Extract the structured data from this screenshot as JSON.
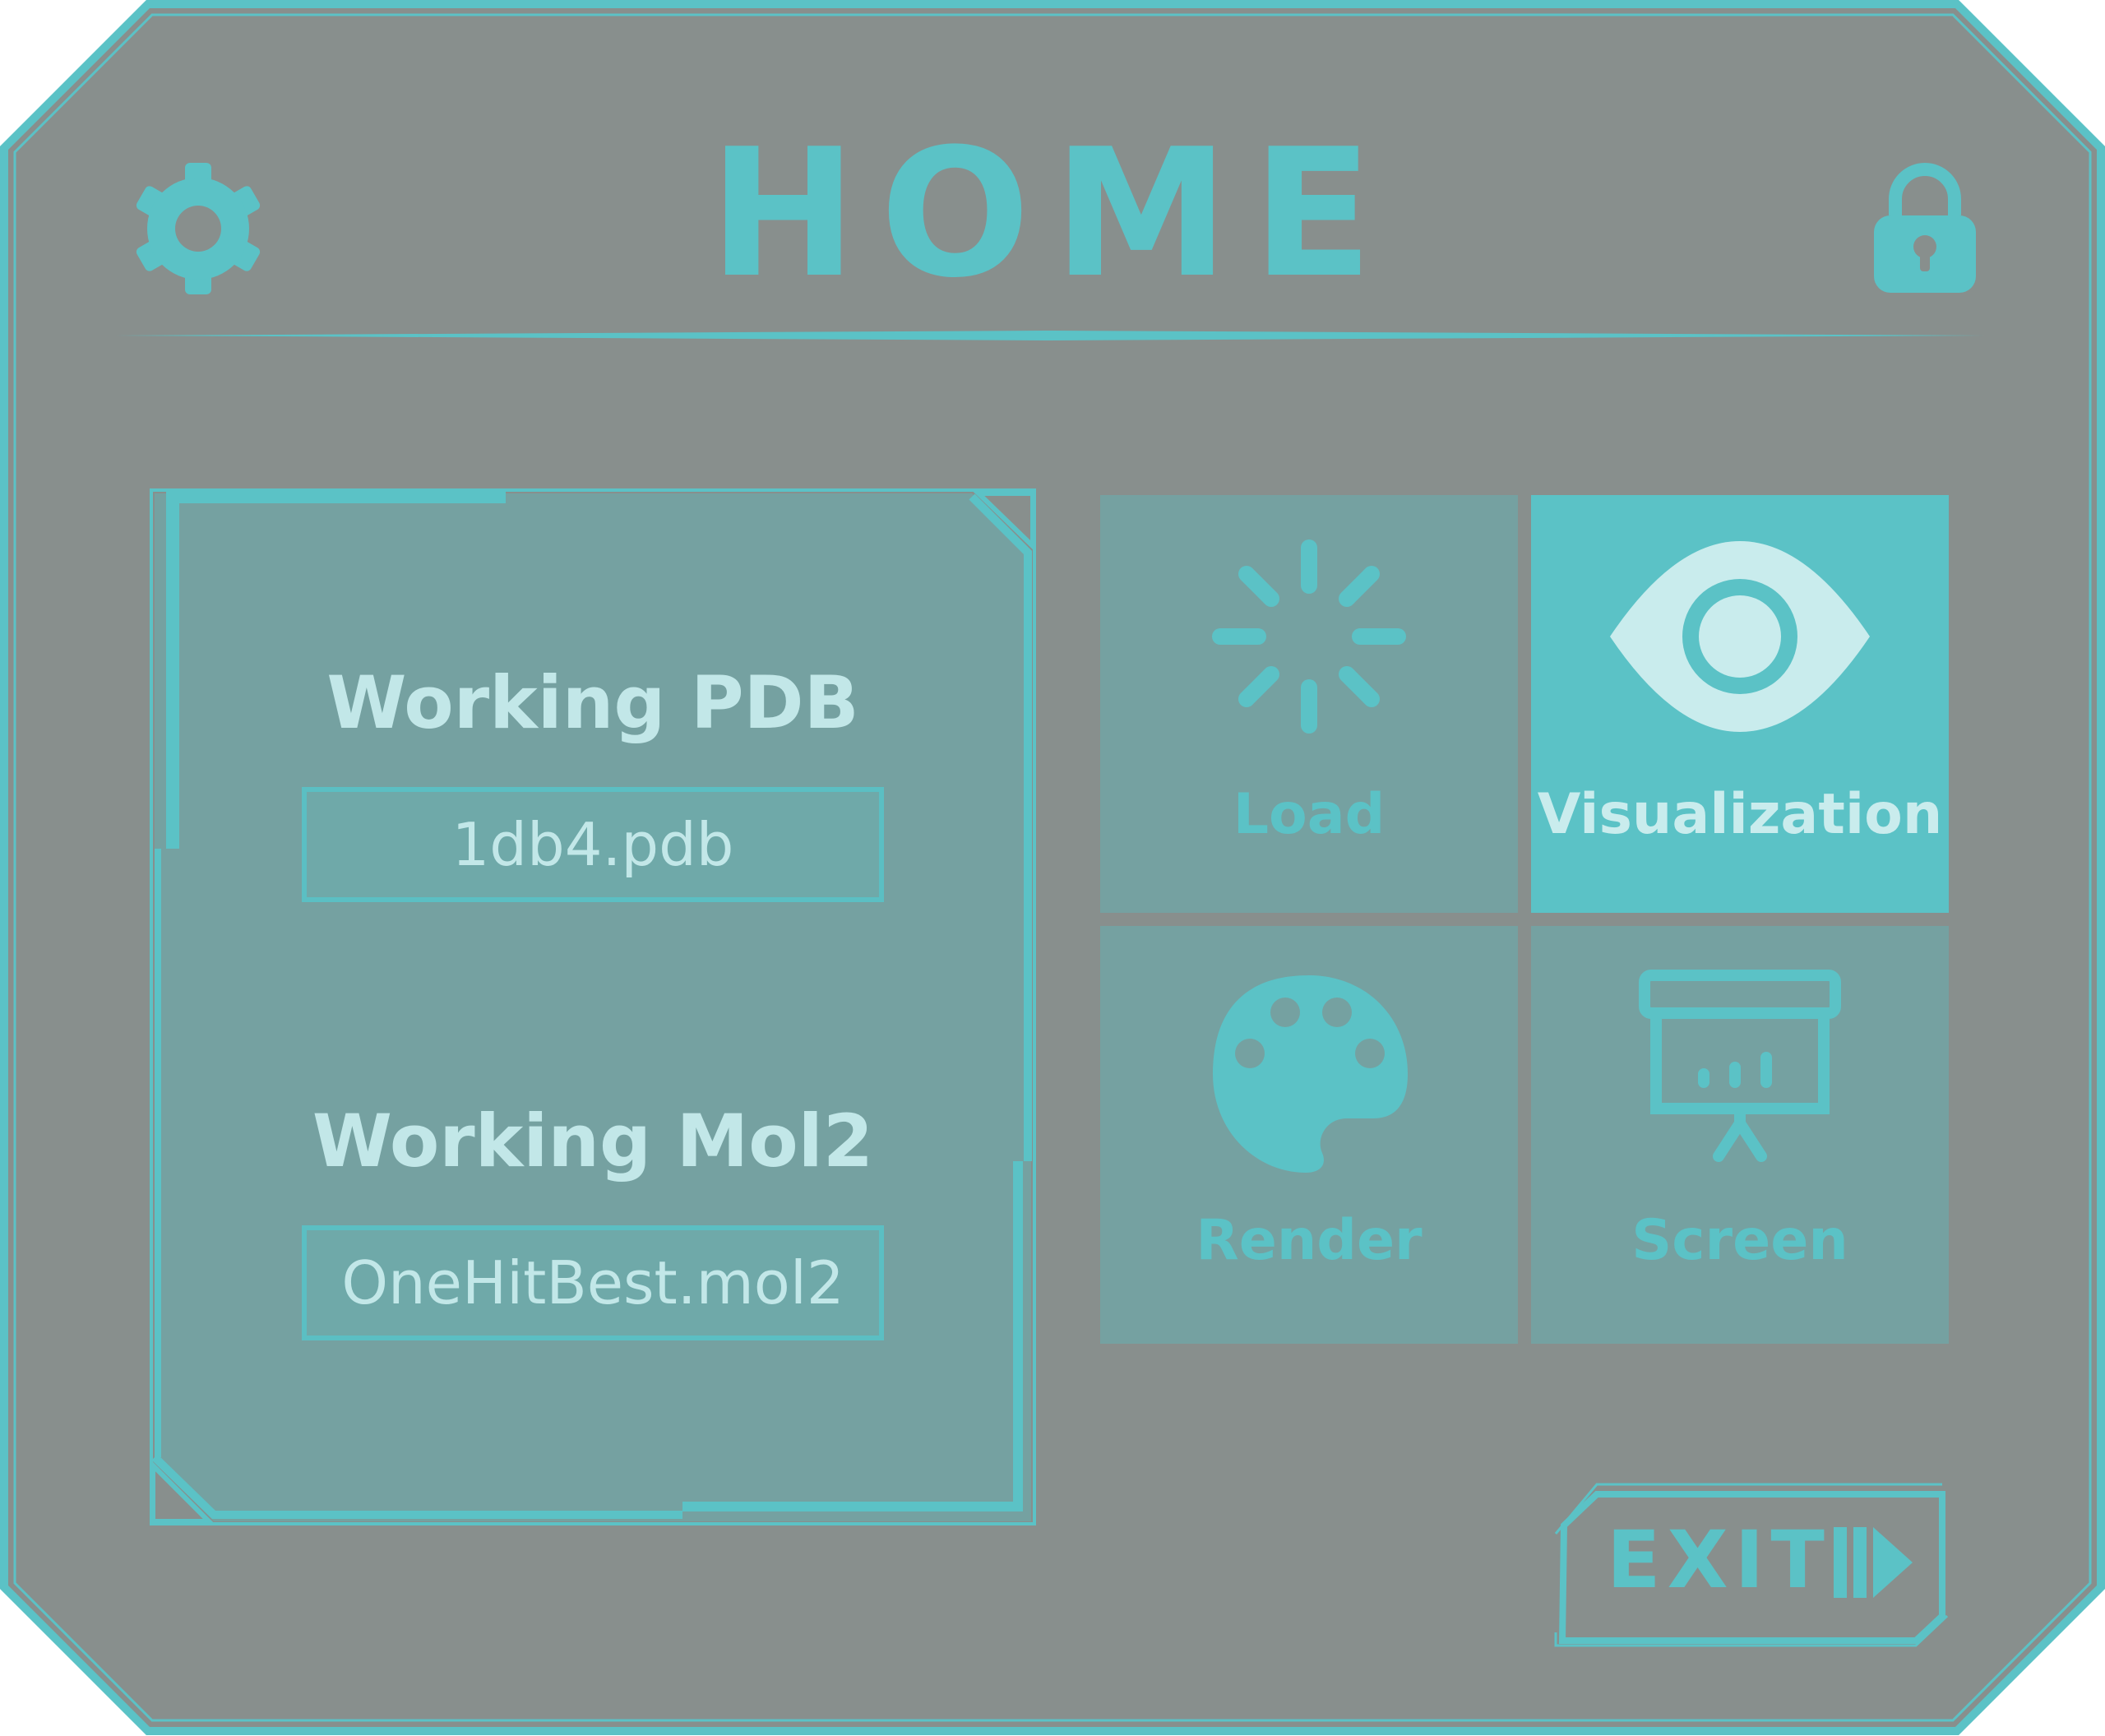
{
  "header": {
    "title": "HOME",
    "settings_icon": "gear-icon",
    "lock_icon": "lock-icon"
  },
  "working": {
    "pdb_label": "Working PDB",
    "pdb_value": "1db4.pdb",
    "mol2_label": "Working Mol2",
    "mol2_value": "OneHitBest.mol2"
  },
  "tiles": [
    {
      "label": "Load",
      "icon": "loading-spinner-icon",
      "active": false
    },
    {
      "label": "Visualization",
      "icon": "eye-icon",
      "active": true
    },
    {
      "label": "Render",
      "icon": "palette-icon",
      "active": false
    },
    {
      "label": "Screen",
      "icon": "presentation-chart-icon",
      "active": false
    }
  ],
  "exit": {
    "label": "EXIT",
    "icon": "exit-arrow-icon"
  },
  "colors": {
    "background": "#888f8d",
    "accent": "#5bc2c6",
    "panel": "#75a1a1",
    "text_light": "#c2e7e8"
  }
}
